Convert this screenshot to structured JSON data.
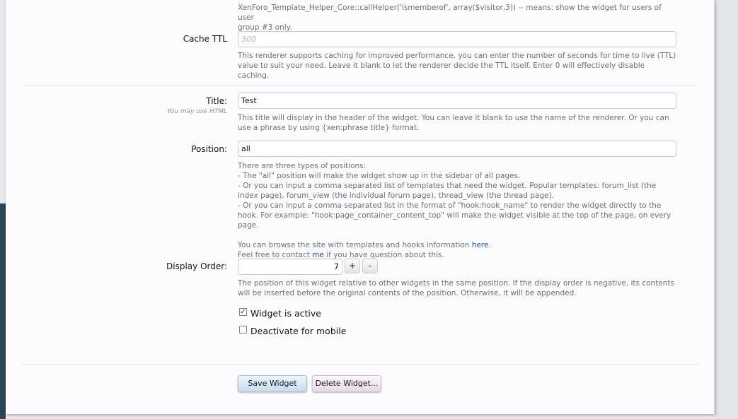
{
  "cache_section": {
    "prev_desc_line1": "XenForo_Template_Helper_Core::callHelper('ismemberof', array($visitor,3)) -- means: show the widget for users of user",
    "prev_desc_line2": "group #3 only.",
    "label": "Cache TTL",
    "placeholder": "300",
    "value": "",
    "desc": "This renderer supports caching for improved performance, you can enter the number of seconds for time to live (TTL) value to suit your need. Leave it blank to let the renderer decide the TTL itself. Enter 0 will effectively disable caching."
  },
  "title_field": {
    "label": "Title:",
    "hint": "You may use HTML",
    "value": "Test",
    "desc": "This title will display in the header of the widget. You can leave it blank to use the name of the renderer. Or you can use a phrase by using {xen:phrase title} format."
  },
  "position_field": {
    "label": "Position:",
    "value": "all",
    "desc_lines": [
      "There are three types of positions:",
      "- The \"all\" position will make the widget show up in the sidebar of all pages.",
      "- Or you can input a comma separated list of templates that need the widget. Popular templates: forum_list (the index page), forum_view (the individual forum page), thread_view (the thread page).",
      "- Or you can input a comma separated list in the format of \"hook:hook_name\" to render the widget directly to the hook. For example: \"hook:page_container_content_top\" will make the widget visible at the top of the page, on every page."
    ],
    "browse_text": "You can browse the site with templates and hooks information",
    "browse_link": "here",
    "browse_end": ".",
    "contact_text": "Feel free to contact",
    "contact_link": "me",
    "contact_end": "if you have question about this."
  },
  "display_order": {
    "label": "Display Order:",
    "value": "7",
    "plus": "+",
    "minus": "-",
    "desc": "The position of this widget relative to other widgets in the same position. If the display order is negative, its contents will be inserted before the original contents of the position. Otherwise, it will be appended."
  },
  "options": {
    "active": {
      "label": "Widget is active",
      "checked": true,
      "mark": "✓"
    },
    "mobile": {
      "label": "Deactivate for mobile",
      "checked": false
    }
  },
  "buttons": {
    "save": "Save Widget",
    "delete": "Delete Widget..."
  }
}
